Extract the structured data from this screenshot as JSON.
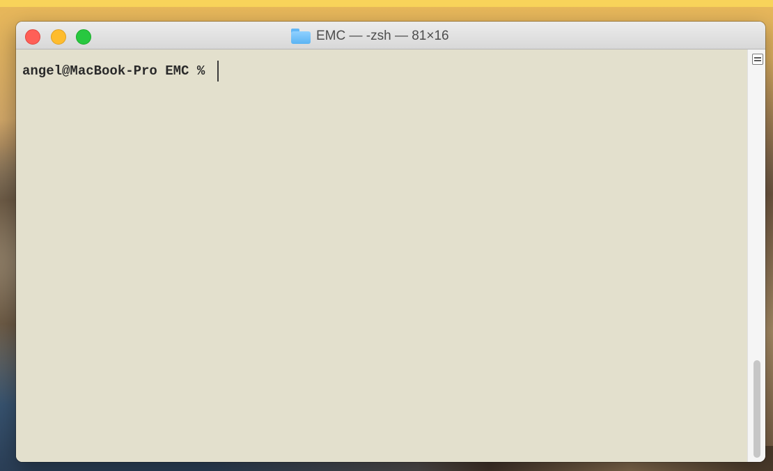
{
  "window": {
    "title": "EMC — -zsh — 81×16",
    "folder_icon": "folder-icon"
  },
  "terminal": {
    "prompt": "angel@MacBook-Pro EMC % "
  },
  "colors": {
    "terminal_background": "#e3e0cd",
    "close": "#ff5f57",
    "minimize": "#febc2e",
    "maximize": "#28c840"
  }
}
